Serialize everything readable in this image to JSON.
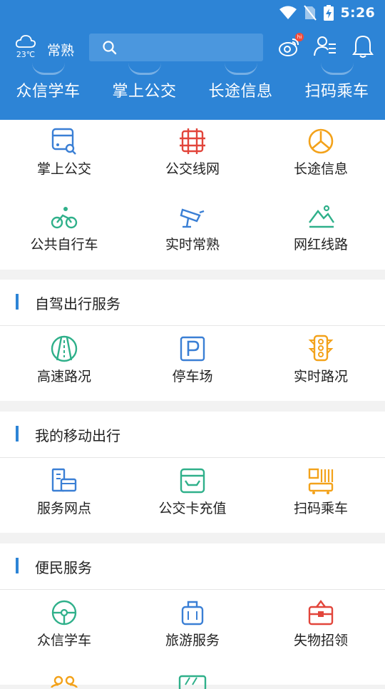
{
  "status_bar": {
    "time": "5:26"
  },
  "header": {
    "temperature": "23℃",
    "city": "常熟",
    "search_placeholder": "",
    "notification_badge": "hi"
  },
  "quick_nav": {
    "items": [
      {
        "label": "众信学车"
      },
      {
        "label": "掌上公交"
      },
      {
        "label": "长途信息"
      },
      {
        "label": "扫码乘车"
      }
    ]
  },
  "public_transit": {
    "items": [
      {
        "label": "掌上公交",
        "icon": "bus-search-icon",
        "color": "#3a7fd5"
      },
      {
        "label": "公交线网",
        "icon": "bus-network-icon",
        "color": "#e2453b"
      },
      {
        "label": "长途信息",
        "icon": "long-distance-icon",
        "color": "#f3a21a"
      },
      {
        "label": "公共自行车",
        "icon": "bicycle-icon",
        "color": "#2fb08a"
      },
      {
        "label": "实时常熟",
        "icon": "camera-icon",
        "color": "#3a7fd5"
      },
      {
        "label": "网红线路",
        "icon": "mountain-icon",
        "color": "#2fb08a"
      }
    ]
  },
  "self_drive": {
    "title": "自驾出行服务",
    "items": [
      {
        "label": "高速路况",
        "icon": "highway-icon",
        "color": "#2fb08a"
      },
      {
        "label": "停车场",
        "icon": "parking-icon",
        "color": "#3a7fd5"
      },
      {
        "label": "实时路况",
        "icon": "traffic-light-icon",
        "color": "#f3a21a"
      }
    ]
  },
  "mobile_travel": {
    "title": "我的移动出行",
    "items": [
      {
        "label": "服务网点",
        "icon": "service-point-icon",
        "color": "#3a7fd5"
      },
      {
        "label": "公交卡充值",
        "icon": "card-topup-icon",
        "color": "#2fb08a"
      },
      {
        "label": "扫码乘车",
        "icon": "qr-ride-icon",
        "color": "#f3a21a"
      }
    ]
  },
  "convenience": {
    "title": "便民服务",
    "items": [
      {
        "label": "众信学车",
        "icon": "steering-wheel-icon",
        "color": "#2fb08a"
      },
      {
        "label": "旅游服务",
        "icon": "luggage-icon",
        "color": "#3a7fd5"
      },
      {
        "label": "失物招领",
        "icon": "lost-found-icon",
        "color": "#e2453b"
      }
    ]
  }
}
